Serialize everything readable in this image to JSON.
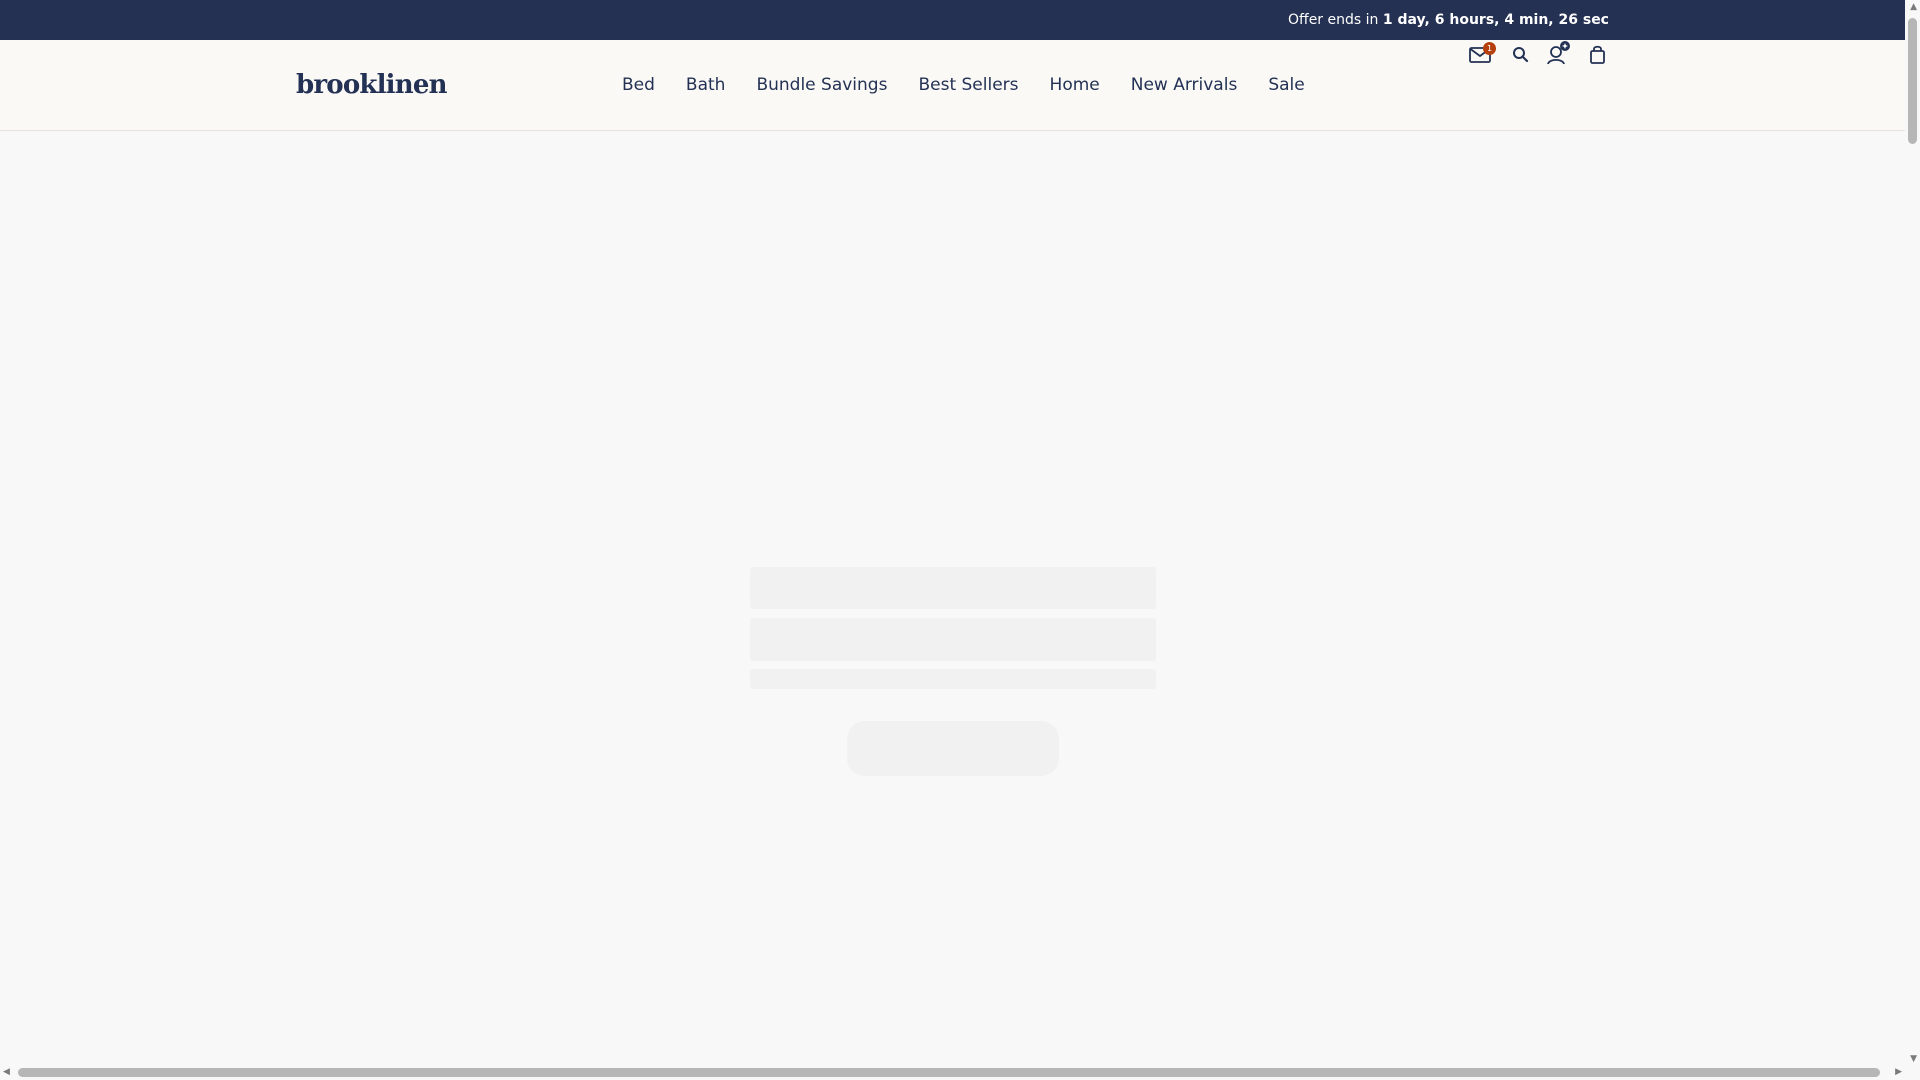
{
  "promo": {
    "prefix": "Offer ends in",
    "countdown": "1 day, 6 hours, 4 min, 26 sec"
  },
  "header": {
    "logo": "brooklinen",
    "nav": [
      "Bed",
      "Bath",
      "Bundle Savings",
      "Best Sellers",
      "Home",
      "New Arrivals",
      "Sale"
    ],
    "icons": {
      "mail": "mail-icon",
      "mail_badge": "1",
      "search": "search-icon",
      "account": "account-icon",
      "cart": "bag-icon"
    }
  },
  "colors": {
    "brand_navy": "#243153",
    "background": "#f8f8f8",
    "header_bg": "#fbf9f6",
    "badge_rust": "#b5400e",
    "skeleton": "#f1f1f1"
  }
}
